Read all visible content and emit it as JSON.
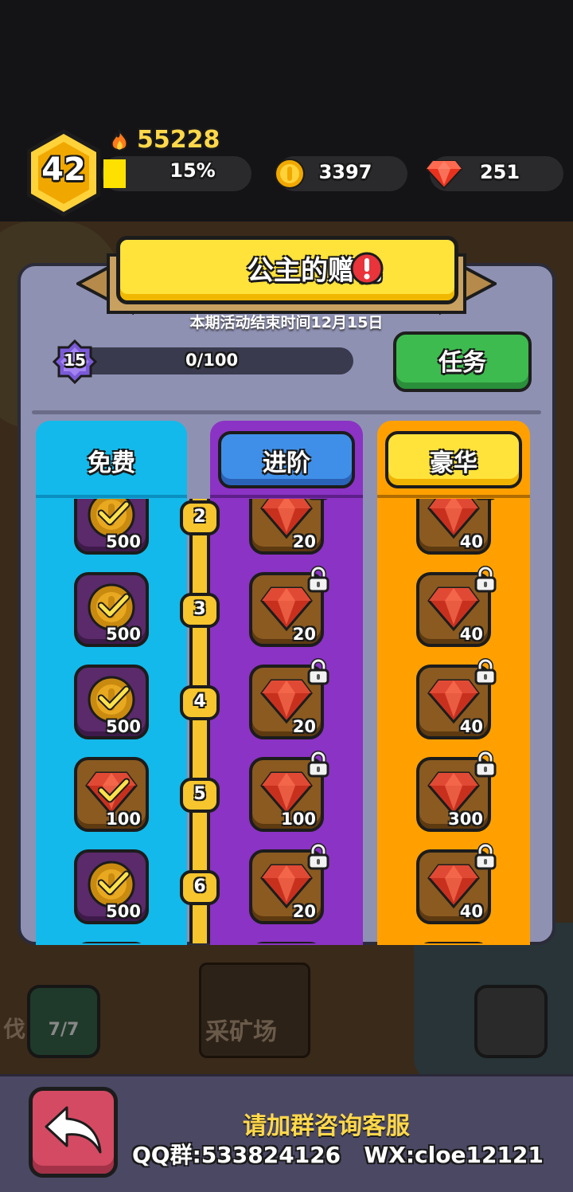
{
  "player": {
    "level": "42",
    "power": "55228",
    "xp_percent_text": "15%",
    "xp_fraction": 0.15,
    "coins": "3397",
    "gems": "251"
  },
  "event": {
    "title": "公主的赠礼",
    "deadline": "本期活动结束时间12月15日",
    "season_level": "15",
    "progress_text": "0/100",
    "task_button": "任务"
  },
  "tiers": {
    "free": "免费",
    "advanced": "进阶",
    "luxury": "豪华"
  },
  "rewards": [
    {
      "level": "2",
      "free": {
        "item": "coin",
        "amount": "500",
        "claimed": true
      },
      "adv": {
        "item": "gem",
        "amount": "20",
        "locked": true
      },
      "lux": {
        "item": "gem",
        "amount": "40",
        "locked": true
      }
    },
    {
      "level": "3",
      "free": {
        "item": "coin",
        "amount": "500",
        "claimed": true
      },
      "adv": {
        "item": "gem",
        "amount": "20",
        "locked": true
      },
      "lux": {
        "item": "gem",
        "amount": "40",
        "locked": true
      }
    },
    {
      "level": "4",
      "free": {
        "item": "coin",
        "amount": "500",
        "claimed": true
      },
      "adv": {
        "item": "gem",
        "amount": "20",
        "locked": true
      },
      "lux": {
        "item": "gem",
        "amount": "40",
        "locked": true
      }
    },
    {
      "level": "5",
      "free": {
        "item": "gem",
        "amount": "100",
        "claimed": true
      },
      "adv": {
        "item": "gem",
        "amount": "100",
        "locked": true
      },
      "lux": {
        "item": "gem",
        "amount": "300",
        "locked": true
      }
    },
    {
      "level": "6",
      "free": {
        "item": "coin",
        "amount": "500",
        "claimed": true
      },
      "adv": {
        "item": "gem",
        "amount": "20",
        "locked": true
      },
      "lux": {
        "item": "gem",
        "amount": "40",
        "locked": true
      }
    }
  ],
  "background": {
    "building_label": "采矿场",
    "side_label": "伐",
    "ball_count": "7/7"
  },
  "footer": {
    "support": "请加群咨询客服",
    "contact": "QQ群:533824126   WX:cloe12121"
  },
  "colors": {
    "free_column": "#13b9ea",
    "advanced_column": "#8b33c4",
    "luxury_column": "#ffa000",
    "panel": "#8f91b3",
    "title_yellow": "#ffe23a",
    "task_green": "#3dbb4f"
  },
  "icons": [
    "fire-icon",
    "coin-icon",
    "gem-icon",
    "alert-icon",
    "lock-icon",
    "check-icon",
    "back-arrow-icon"
  ]
}
